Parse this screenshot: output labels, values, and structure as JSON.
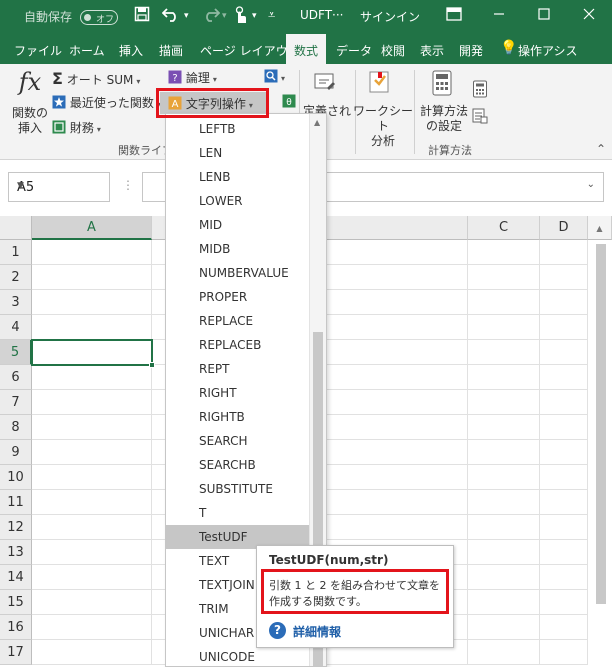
{
  "titlebar": {
    "autosave_label": "自動保存",
    "autosave_state": "オフ",
    "filename": "UDFT···",
    "signin": "サインイン"
  },
  "tabs": [
    "ファイル",
    "ホーム",
    "挿入",
    "描画",
    "ページ レイアウト",
    "数式",
    "データ",
    "校閲",
    "表示",
    "開発",
    "操作アシス"
  ],
  "active_tab": "数式",
  "ribbon": {
    "insert_function_label": "関数の\n挿入",
    "autosum_label": "オート SUM",
    "recent_label": "最近使った関数",
    "financial_label": "財務",
    "logical_label": "論理",
    "text_label": "文字列操作",
    "group_library_label": "関数ライブ",
    "defined_names_label": "定義され\n名前",
    "formula_auditing_label": "ワークシート\n分析",
    "calc_options_label": "計算方法\nの設定",
    "group_calc_label": "計算方法"
  },
  "formula_bar": {
    "namebox_value": "A5"
  },
  "columns": [
    "A",
    "C",
    "D"
  ],
  "rows": [
    "1",
    "2",
    "3",
    "4",
    "5",
    "6",
    "7",
    "8",
    "9",
    "10",
    "11",
    "12",
    "13",
    "14",
    "15",
    "16",
    "17"
  ],
  "selected_row": "5",
  "menu": {
    "items": [
      "LEFTB",
      "LEN",
      "LENB",
      "LOWER",
      "MID",
      "MIDB",
      "NUMBERVALUE",
      "PROPER",
      "REPLACE",
      "REPLACEB",
      "REPT",
      "RIGHT",
      "RIGHTB",
      "SEARCH",
      "SEARCHB",
      "SUBSTITUTE",
      "T",
      "TestUDF",
      "TEXT",
      "TEXTJOIN",
      "TRIM",
      "UNICHAR",
      "UNICODE"
    ],
    "highlighted": "TestUDF"
  },
  "tooltip": {
    "title": "TestUDF(num,str)",
    "description": "引数 1 と 2 を組み合わせて文章を作成する関数です。",
    "link": "詳細情報"
  },
  "colors": {
    "excel_green": "#217346",
    "highlight_red": "#e3141b",
    "menu_highlight": "#c6c6c6"
  }
}
